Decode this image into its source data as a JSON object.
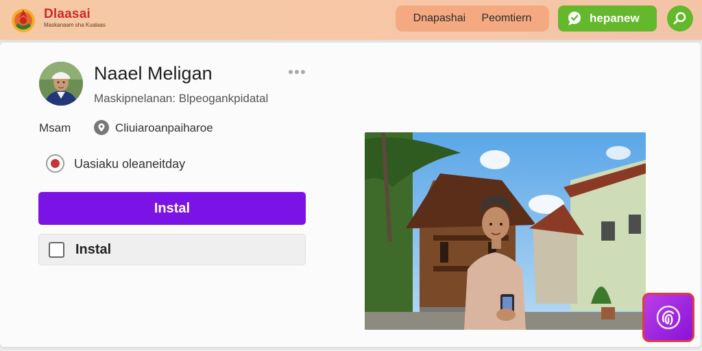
{
  "header": {
    "brand_name": "Dlaasai",
    "brand_tagline": "Maskanaam sha Kualaas",
    "nav": [
      "Dnapashai",
      "Peomtiern"
    ],
    "cta_label": "hepanew"
  },
  "profile": {
    "name": "Naael Meligan",
    "subtitle": "Maskipnelanan: Blpeogankpidatal"
  },
  "meta": {
    "label": "Msam",
    "value": "Cliuiaroanpaiharoe"
  },
  "option": {
    "label": "Uasiaku oleaneitday",
    "selected": true
  },
  "actions": {
    "primary_label": "Instal",
    "secondary_label": "Instal"
  },
  "colors": {
    "accent": "#7c13e6",
    "header_bg": "#f6c9a4",
    "cta": "#63b82b",
    "brand_red": "#cc2a2a",
    "fab_border": "#e23b3b"
  },
  "icons": {
    "logo": "emblem-logo",
    "cta": "chat-bubble-icon",
    "round": "search-icon",
    "more": "more-dots-icon",
    "meta": "location-icon",
    "fab": "fingerprint-icon"
  }
}
